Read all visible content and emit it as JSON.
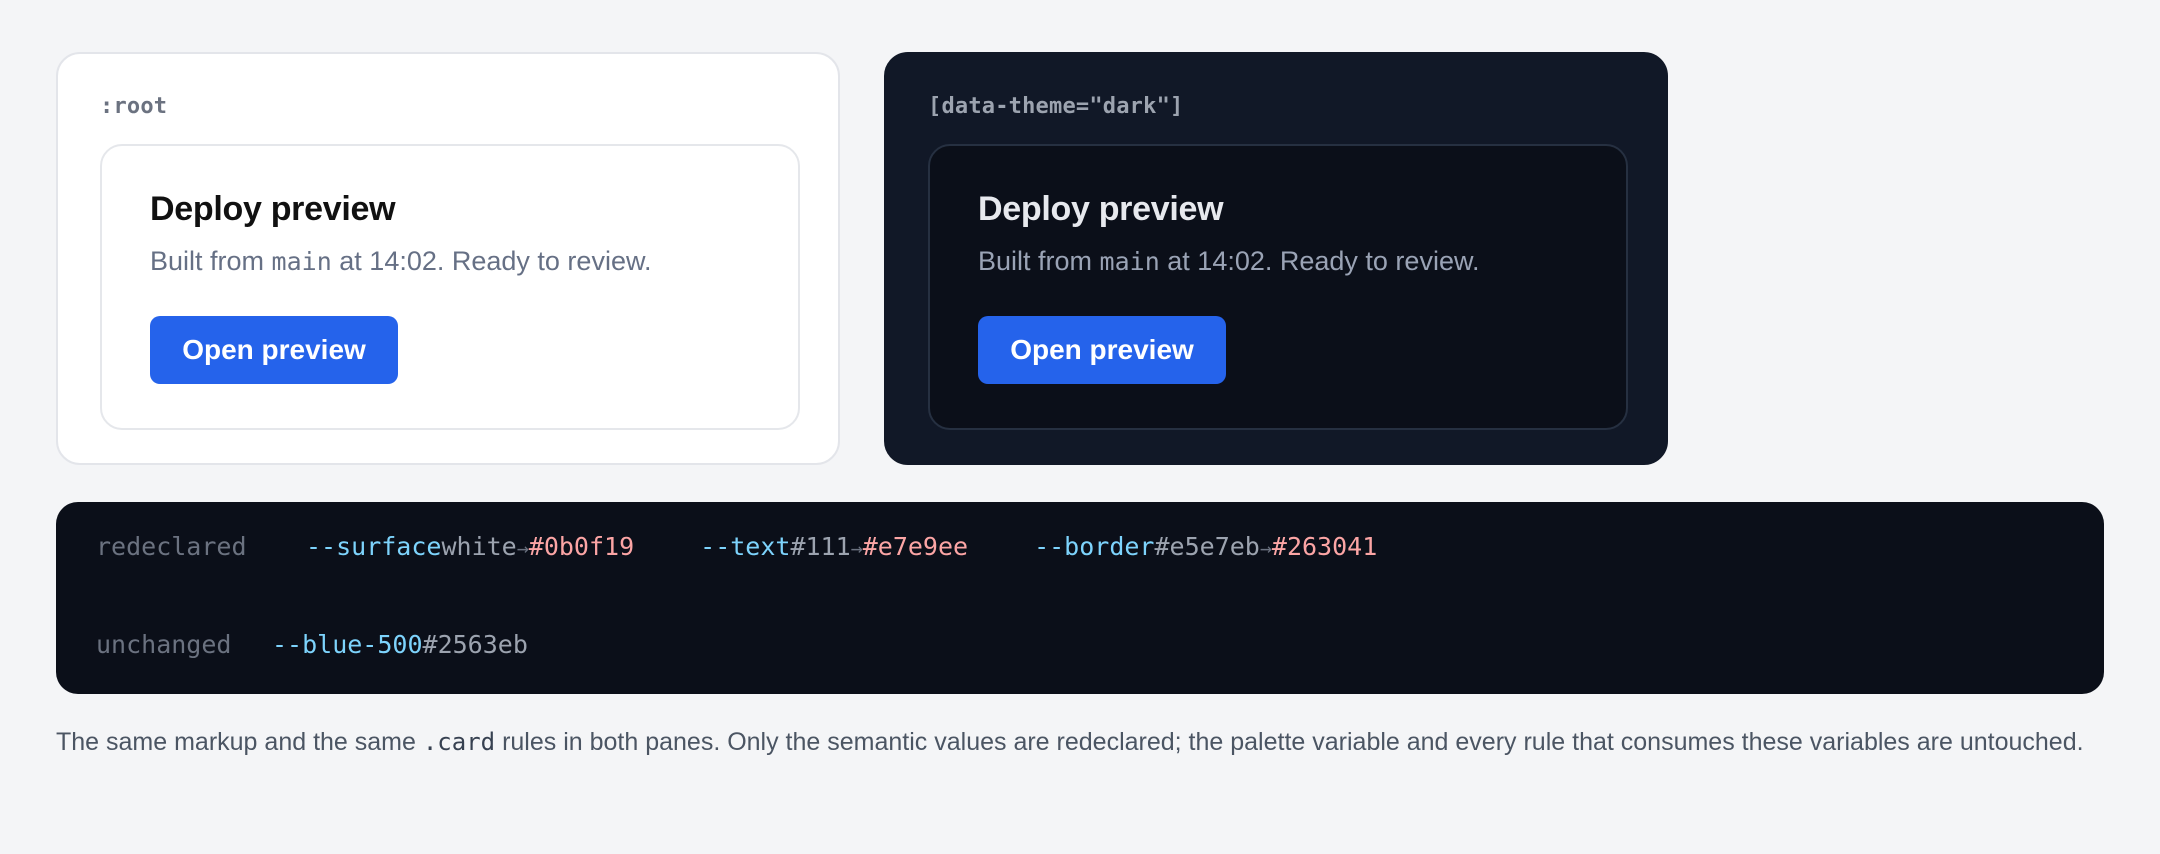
{
  "panes": {
    "light": {
      "selector": ":root",
      "card": {
        "title": "Deploy preview",
        "desc_before": "Built from",
        "branch": "main",
        "desc_after": "at 14:02. Ready to review.",
        "button": "Open preview"
      }
    },
    "dark": {
      "selector": "[data-theme=\"dark\"]",
      "card": {
        "title": "Deploy preview",
        "desc_before": "Built from",
        "branch": "main",
        "desc_after": "at 14:02. Ready to review.",
        "button": "Open preview"
      }
    }
  },
  "variables": {
    "redeclared_label": "redeclared",
    "arrow": "→",
    "redeclared": [
      {
        "name": "--surface",
        "from": "white",
        "to": "#0b0f19"
      },
      {
        "name": "--text",
        "from": "#111",
        "to": "#e7e9ee"
      },
      {
        "name": "--border",
        "from": "#e5e7eb",
        "to": "#263041"
      }
    ],
    "unchanged_label": "unchanged",
    "unchanged": [
      {
        "name": "--blue-500",
        "value": "#2563eb"
      }
    ]
  },
  "footnote": {
    "before": "The same markup and the same",
    "code": ".card",
    "after": "rules in both panes. Only the semantic values are redeclared; the palette variable and every rule that consumes these variables are untouched."
  },
  "colors": {
    "page_bg": "#f4f5f7",
    "accent": "#2563eb",
    "dark_surface": "#0b0f19",
    "dark_text": "#e7e9ee",
    "dark_border": "#263041",
    "var_name": "#7dd3fc",
    "var_new": "#fca5a5"
  }
}
